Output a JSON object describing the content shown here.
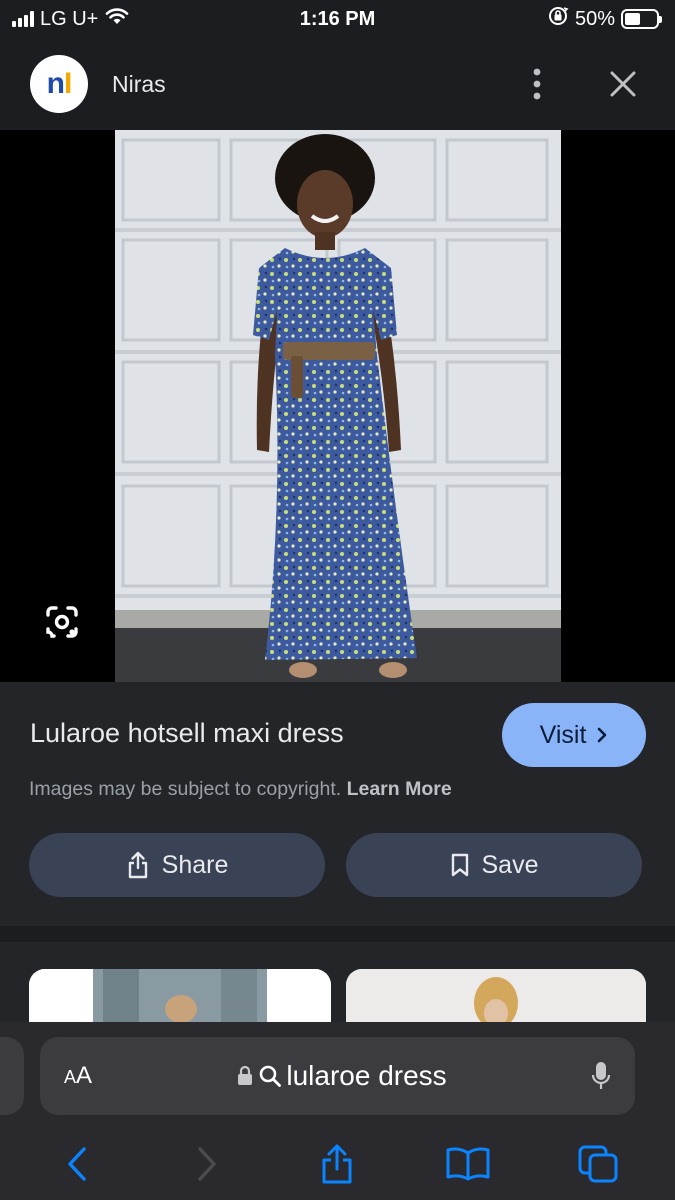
{
  "status_bar": {
    "carrier": "LG U+",
    "time": "1:16 PM",
    "battery": "50%",
    "battery_level": 0.5
  },
  "header": {
    "logo_letters": "nI",
    "site_name": "Niras"
  },
  "result": {
    "title": "Lularoe hotsell maxi dress",
    "visit_label": "Visit",
    "copyright_text": "Images may be subject to copyright.",
    "learn_more": "Learn More",
    "share_label": "Share",
    "save_label": "Save"
  },
  "safari": {
    "text_size_label": "AA",
    "url_text": "lularoe dress"
  },
  "colors": {
    "accent": "#8ab4f8",
    "button_bg": "#3a4356",
    "panel_bg": "#232529",
    "safari_blue": "#0a84ff"
  }
}
